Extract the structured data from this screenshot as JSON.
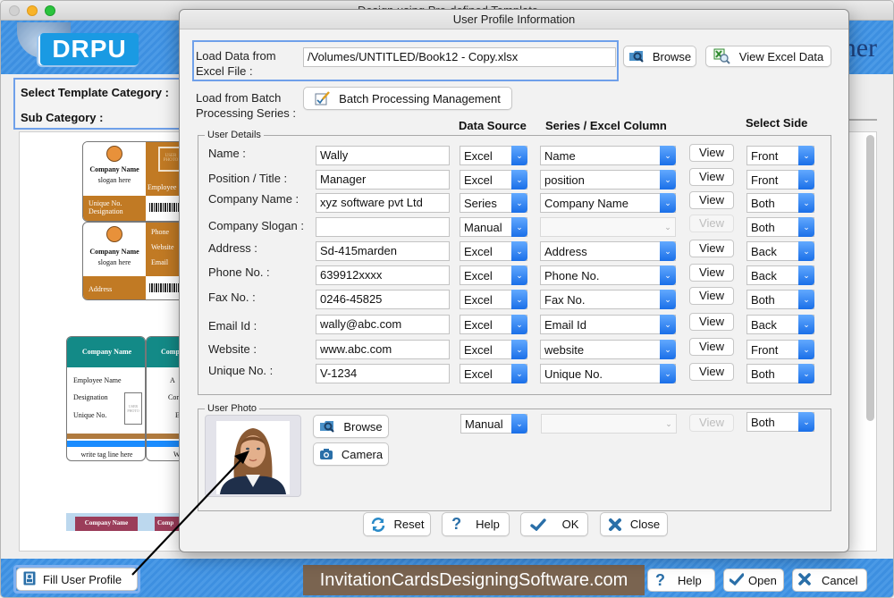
{
  "main_window": {
    "title": "Design using Pre-defined Template",
    "logo": "DRPU",
    "banner_right_text": "ner",
    "category_label": "Select Template Category :",
    "subcategory_label": "Sub Category :",
    "templates": [
      {
        "company": "Company Name",
        "slogan": "slogan here",
        "photo": "USER PHOTO",
        "employee": "Employee",
        "unique": "Unique No.",
        "designation": "Designation"
      },
      {
        "company": "Company Name",
        "slogan": "slogan here",
        "phone": "Phone",
        "website": "Website",
        "email": "Email",
        "address": "Address"
      },
      {
        "company": "Company Name",
        "employee": "Employee Name",
        "designation": "Designation",
        "unique": "Unique No.",
        "photo": "USER PHOTO",
        "tagline": "write tag line here",
        "company2": "Comp",
        "a2": "A",
        "c2": "Con",
        "e2": "E",
        "w2": "W"
      },
      {
        "company": "Company Name",
        "company2": "Comp"
      }
    ],
    "bottom": {
      "fill_user_profile": "Fill User Profile",
      "website": "InvitationCardsDesigningSoftware.com",
      "help": "Help",
      "open": "Open",
      "cancel": "Cancel"
    }
  },
  "dialog": {
    "title": "User Profile Information",
    "excel_label": "Load Data from Excel File :",
    "excel_label_line1": "Load Data from",
    "excel_label_line2": "Excel File :",
    "excel_path": "/Volumes/UNTITLED/Book12 - Copy.xlsx",
    "browse": "Browse",
    "view_excel": "View Excel Data",
    "batch_label_line1": "Load from Batch",
    "batch_label_line2": "Processing Series :",
    "batch_button": "Batch Processing Management",
    "columns": {
      "data_source": "Data Source",
      "series_column": "Series / Excel Column",
      "select_side": "Select Side"
    },
    "user_details_title": "User Details",
    "fields": [
      {
        "label": "Name :",
        "value": "Wally",
        "source": "Excel",
        "column": "Name",
        "view": "View",
        "side": "Front",
        "disabled": false
      },
      {
        "label": "Position / Title :",
        "value": "Manager",
        "source": "Excel",
        "column": "position",
        "view": "View",
        "side": "Front",
        "disabled": false
      },
      {
        "label": "Company Name :",
        "value": "xyz software pvt Ltd",
        "source": "Series",
        "column": "Company Name",
        "view": "View",
        "side": "Both",
        "disabled": false
      },
      {
        "label": "Company Slogan :",
        "value": "",
        "source": "Manual",
        "column": "",
        "view": "View",
        "side": "Both",
        "disabled": true
      },
      {
        "label": "Address :",
        "value": "Sd-415marden",
        "source": "Excel",
        "column": "Address",
        "view": "View",
        "side": "Back",
        "disabled": false
      },
      {
        "label": "Phone No. :",
        "value": "639912xxxx",
        "source": "Excel",
        "column": "Phone No.",
        "view": "View",
        "side": "Back",
        "disabled": false
      },
      {
        "label": "Fax No. :",
        "value": "0246-45825",
        "source": "Excel",
        "column": "Fax No.",
        "view": "View",
        "side": "Both",
        "disabled": false
      },
      {
        "label": "Email Id :",
        "value": "wally@abc.com",
        "source": "Excel",
        "column": "Email Id",
        "view": "View",
        "side": "Back",
        "disabled": false
      },
      {
        "label": "Website :",
        "value": "www.abc.com",
        "source": "Excel",
        "column": "website",
        "view": "View",
        "side": "Front",
        "disabled": false
      },
      {
        "label": "Unique No. :",
        "value": "V-1234",
        "source": "Excel",
        "column": "Unique No.",
        "view": "View",
        "side": "Both",
        "disabled": false
      }
    ],
    "user_photo": {
      "title": "User Photo",
      "browse": "Browse",
      "camera": "Camera",
      "source": "Manual",
      "column": "",
      "view": "View",
      "side": "Both"
    },
    "buttons": {
      "reset": "Reset",
      "help": "Help",
      "ok": "OK",
      "close": "Close"
    }
  },
  "colors": {
    "accent_blue": "#1a6fe8",
    "focus_ring": "#6fa0ea",
    "banner_blue": "#4b9ae6",
    "card_orange": "#c17a24",
    "card_teal": "#138a87",
    "card_maroon": "#9b3d5a",
    "website_banner": "#7a6450",
    "icon_blue": "#2a6fa8"
  }
}
